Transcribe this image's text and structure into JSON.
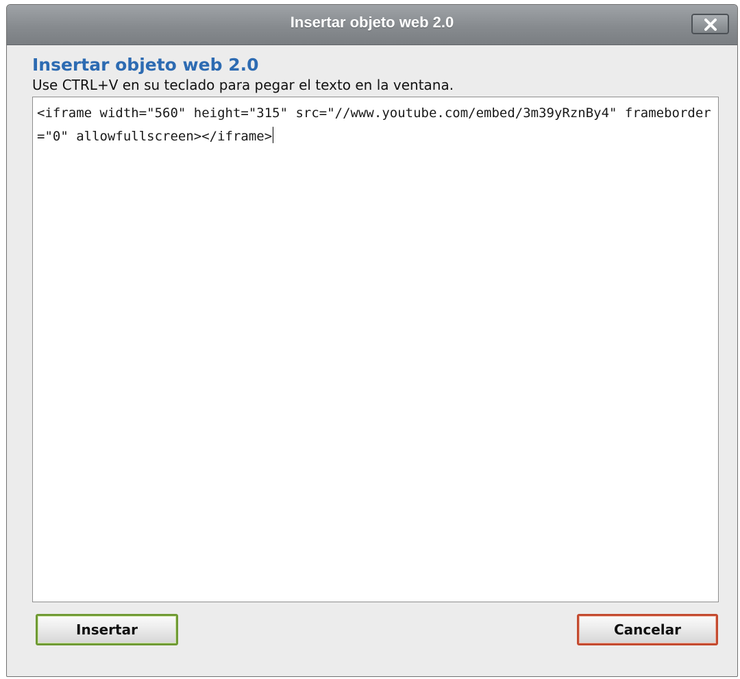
{
  "dialog": {
    "title": "Insertar objeto web 2.0",
    "close_label": "close"
  },
  "content": {
    "heading": "Insertar objeto web 2.0",
    "instructions": "Use CTRL+V en su teclado para pegar el texto en la ventana.",
    "textarea_value": "<iframe width=\"560\" height=\"315\" src=\"//www.youtube.com/embed/3m39yRznBy4\" frameborder=\"0\" allowfullscreen></iframe>"
  },
  "buttons": {
    "insert_label": "Insertar",
    "cancel_label": "Cancelar"
  },
  "colors": {
    "heading": "#2d6bb2",
    "insert_border": "#6f9a34",
    "cancel_border": "#c34a2f",
    "titlebar": "#878b8f"
  },
  "icons": {
    "close": "close-icon"
  }
}
